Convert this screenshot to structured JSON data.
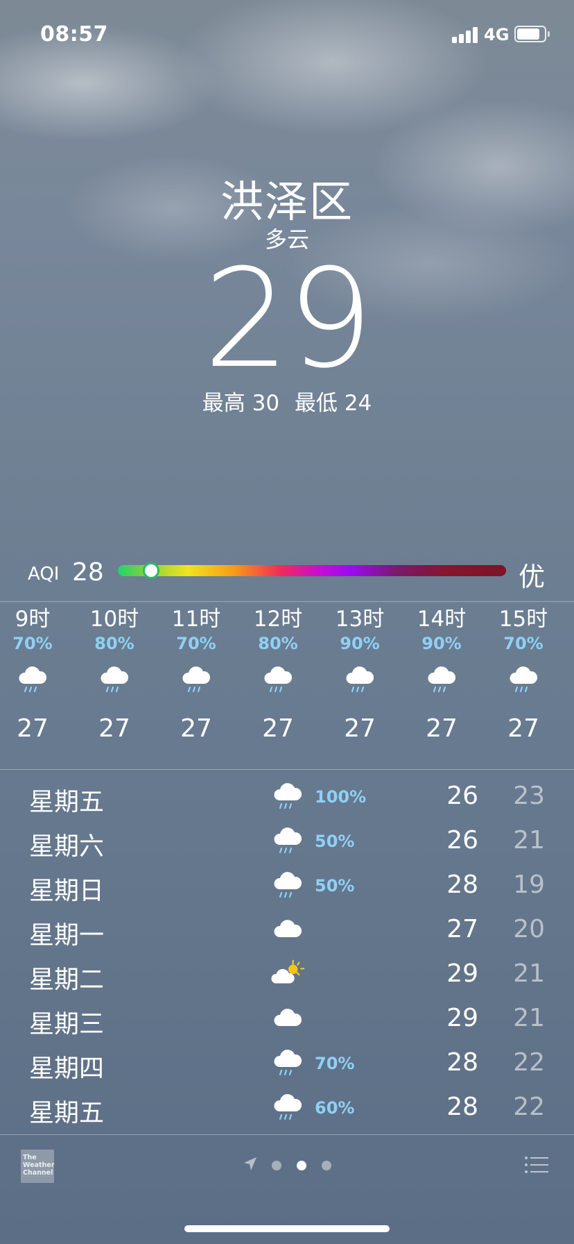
{
  "status_bar": {
    "time": "08:57",
    "network": "4G",
    "battery_fraction": 0.85
  },
  "location": {
    "city": "洪泽区",
    "condition": "多云",
    "temperature": "29",
    "high_label": "最高",
    "high": "30",
    "low_label": "最低",
    "low": "24"
  },
  "aqi": {
    "label": "AQI",
    "value": "28",
    "level": "优",
    "position_fraction": 0.085
  },
  "hourly": [
    {
      "time": "9时",
      "pop": "70%",
      "icon": "rain-cloud-icon",
      "temp": "27"
    },
    {
      "time": "10时",
      "pop": "80%",
      "icon": "rain-cloud-icon",
      "temp": "27"
    },
    {
      "time": "11时",
      "pop": "70%",
      "icon": "rain-cloud-icon",
      "temp": "27"
    },
    {
      "time": "12时",
      "pop": "80%",
      "icon": "rain-cloud-icon",
      "temp": "27"
    },
    {
      "time": "13时",
      "pop": "90%",
      "icon": "rain-cloud-icon",
      "temp": "27"
    },
    {
      "time": "14时",
      "pop": "90%",
      "icon": "rain-cloud-icon",
      "temp": "27"
    },
    {
      "time": "15时",
      "pop": "70%",
      "icon": "rain-cloud-icon",
      "temp": "27"
    }
  ],
  "daily": [
    {
      "day": "星期五",
      "icon": "rain-cloud-icon",
      "pop": "100%",
      "high": "26",
      "low": "23"
    },
    {
      "day": "星期六",
      "icon": "rain-cloud-icon",
      "pop": "50%",
      "high": "26",
      "low": "21"
    },
    {
      "day": "星期日",
      "icon": "rain-cloud-icon",
      "pop": "50%",
      "high": "28",
      "low": "19"
    },
    {
      "day": "星期一",
      "icon": "cloud-icon",
      "pop": "",
      "high": "27",
      "low": "20"
    },
    {
      "day": "星期二",
      "icon": "partly-sunny-icon",
      "pop": "",
      "high": "29",
      "low": "21"
    },
    {
      "day": "星期三",
      "icon": "cloud-icon",
      "pop": "",
      "high": "29",
      "low": "21"
    },
    {
      "day": "星期四",
      "icon": "rain-cloud-icon",
      "pop": "70%",
      "high": "28",
      "low": "22"
    },
    {
      "day": "星期五",
      "icon": "rain-cloud-icon",
      "pop": "60%",
      "high": "28",
      "low": "22"
    }
  ],
  "footer": {
    "logo_text": "The Weather Channel",
    "page_count": 3,
    "active_page": 1
  },
  "colors": {
    "pop_blue": "#8fd0f5",
    "aqi_knob_border": "#2fb86a"
  }
}
